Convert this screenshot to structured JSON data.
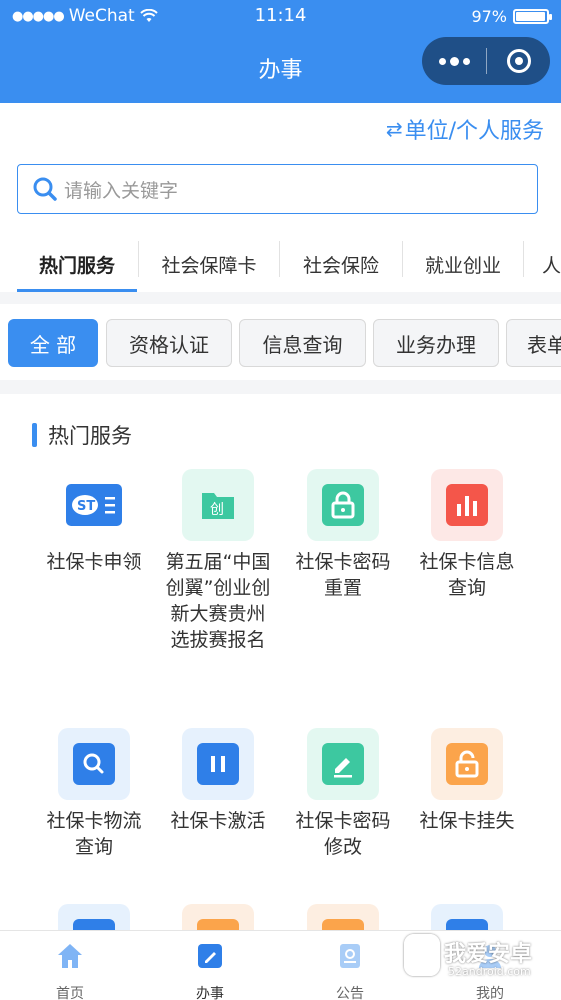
{
  "status_bar": {
    "carrier": "WeChat",
    "time": "11:14",
    "battery": "97%"
  },
  "nav": {
    "title": "办事"
  },
  "switch_label": "单位/个人服务",
  "search": {
    "placeholder": "请输入关键字"
  },
  "tabs": [
    "热门服务",
    "社会保障卡",
    "社会保险",
    "就业创业",
    "人"
  ],
  "chips": [
    "全 部",
    "资格认证",
    "信息查询",
    "业务办理",
    "表单"
  ],
  "section": {
    "title": "热门服务"
  },
  "services": [
    {
      "label": "社保卡申领",
      "icon": "social-card-icon"
    },
    {
      "label": "第五届“中国创翼”创业创新大赛贵州选拔赛报名",
      "icon": "folder-chuang-icon"
    },
    {
      "label": "社保卡密码重置",
      "icon": "lock-icon"
    },
    {
      "label": "社保卡信息查询",
      "icon": "bar-chart-icon"
    },
    {
      "label": "社保卡物流查询",
      "icon": "search-icon"
    },
    {
      "label": "社保卡激活",
      "icon": "pause-icon"
    },
    {
      "label": "社保卡密码修改",
      "icon": "edit-icon"
    },
    {
      "label": "社保卡挂失",
      "icon": "unlock-icon"
    }
  ],
  "colors": {
    "accent": "#3a8ef0",
    "nav_bg": "#3a8ef0",
    "capsule_bg": "#1f4f87"
  },
  "bottom_nav": [
    "首页",
    "办事",
    "公告",
    "我的"
  ],
  "watermark": {
    "name": "我爱安卓",
    "url": "52android.com"
  }
}
